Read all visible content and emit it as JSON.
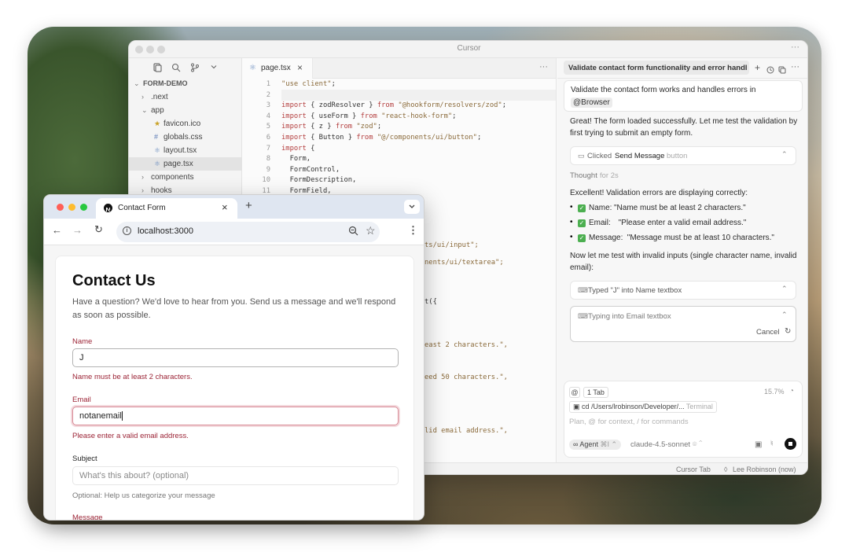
{
  "cursor": {
    "window_title": "Cursor",
    "more": "···",
    "sidebar": {
      "icons": [
        "files-icon",
        "search-icon",
        "source-control-icon",
        "chevron-down-icon"
      ],
      "tree": [
        {
          "label": "FORM-DEMO",
          "level": 0,
          "open": true,
          "type": "folder"
        },
        {
          "label": ".next",
          "level": 1,
          "open": false,
          "type": "folder"
        },
        {
          "label": "app",
          "level": 1,
          "open": true,
          "type": "folder"
        },
        {
          "label": "favicon.ico",
          "level": 2,
          "type": "file",
          "icon": "★"
        },
        {
          "label": "globals.css",
          "level": 2,
          "type": "file",
          "icon": "#"
        },
        {
          "label": "layout.tsx",
          "level": 2,
          "type": "file",
          "icon": "⚛"
        },
        {
          "label": "page.tsx",
          "level": 2,
          "type": "file",
          "icon": "⚛",
          "selected": true
        },
        {
          "label": "components",
          "level": 1,
          "open": false,
          "type": "folder"
        },
        {
          "label": "hooks",
          "level": 1,
          "open": false,
          "type": "folder"
        }
      ]
    },
    "editor": {
      "tab_label": "page.tsx",
      "tab_close": "×",
      "more": "···",
      "lines": [
        {
          "n": "1",
          "text": "\"use client\";"
        },
        {
          "n": "2",
          "text": ""
        },
        {
          "n": "3",
          "text": "import { zodResolver } from \"@hookform/resolvers/zod\";"
        },
        {
          "n": "4",
          "text": "import { useForm } from \"react-hook-form\";"
        },
        {
          "n": "5",
          "text": "import { z } from \"zod\";"
        },
        {
          "n": "6",
          "text": "import { Button } from \"@/components/ui/button\";"
        },
        {
          "n": "7",
          "text": "import {"
        },
        {
          "n": "8",
          "text": "  Form,"
        },
        {
          "n": "9",
          "text": "  FormControl,"
        },
        {
          "n": "10",
          "text": "  FormDescription,"
        },
        {
          "n": "11",
          "text": "  FormField,"
        }
      ],
      "fragments": [
        "ts/ui/input\";",
        "nents/ui/textarea\";",
        "t({",
        "east 2 characters.\",",
        "eed 50 characters.\",",
        "lid email address.\","
      ]
    },
    "chat": {
      "header_title": "Validate contact form functionality and error handlin",
      "header_icons": [
        "plus-icon",
        "history-icon",
        "copy-icon",
        "more-icon"
      ],
      "user_message": "Validate the contact form works and handles errors in",
      "user_mention": "@Browser",
      "msg1": "Great! The form loaded successfully. Let me test the validation by first trying to submit an empty form.",
      "tool1_prefix": "Clicked",
      "tool1_bold": "Send Message",
      "tool1_suffix": "button",
      "thought_label": "Thought",
      "thought_time": "for 2s",
      "msg2": "Excellent! Validation errors are displaying correctly:",
      "bullets": [
        {
          "field": "Name:",
          "text": "\"Name must be at least 2 characters.\""
        },
        {
          "field": "Email:",
          "text": "\"Please enter a valid email address.\""
        },
        {
          "field": "Message:",
          "text": "\"Message must be at least 10 characters.\""
        }
      ],
      "msg3": "Now let me test with invalid inputs (single character name, invalid email):",
      "tool2": "Typed \"J\" into Name textbox",
      "tool3": "Typing into Email textbox",
      "cancel": "Cancel",
      "composer": {
        "at": "@",
        "tab_chip": "1 Tab",
        "percent": "15.7%",
        "context_chip": "cd /Users/lrobinson/Developer/...",
        "context_type": "Terminal",
        "placeholder": "Plan, @ for context, / for commands",
        "agent": "Agent",
        "agent_shortcut": "⌘I",
        "model": "claude-4.5-sonnet"
      }
    },
    "statusbar": {
      "cursor_tab": "Cursor Tab",
      "author": "Lee Robinson (now)"
    }
  },
  "browser": {
    "tab_title": "Contact Form",
    "tab_close": "×",
    "new_tab": "+",
    "address": "localhost:3000",
    "form": {
      "title": "Contact Us",
      "intro": "Have a question? We'd love to hear from you. Send us a message and we'll respond as soon as possible.",
      "name_label": "Name",
      "name_value": "J",
      "name_error": "Name must be at least 2 characters.",
      "email_label": "Email",
      "email_value": "notanemail",
      "email_error": "Please enter a valid email address.",
      "subject_label": "Subject",
      "subject_placeholder": "What's this about? (optional)",
      "subject_help": "Optional: Help us categorize your message",
      "message_label": "Message"
    }
  },
  "colors": {
    "error": "#9b2335",
    "accent_green": "#4caf50",
    "traffic_red": "#ff5f57",
    "traffic_yellow": "#febc2e",
    "traffic_green": "#28c840"
  }
}
